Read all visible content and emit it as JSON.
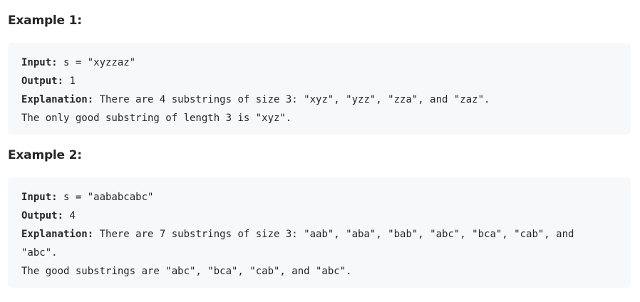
{
  "examples": [
    {
      "heading": "Example 1:",
      "input_label": "Input:",
      "input_value": " s = \"xyzzaz\"",
      "output_label": "Output:",
      "output_value": " 1",
      "explanation_label": "Explanation:",
      "explanation_lines": [
        " There are 4 substrings of size 3: \"xyz\", \"yzz\", \"zza\", and \"zaz\".",
        "The only good substring of length 3 is \"xyz\"."
      ]
    },
    {
      "heading": "Example 2:",
      "input_label": "Input:",
      "input_value": " s = \"aababcabc\"",
      "output_label": "Output:",
      "output_value": " 4",
      "explanation_label": "Explanation:",
      "explanation_lines": [
        " There are 7 substrings of size 3: \"aab\", \"aba\", \"bab\", \"abc\", \"bca\", \"cab\", and",
        "\"abc\".",
        "The good substrings are \"abc\", \"bca\", \"cab\", and \"abc\"."
      ]
    }
  ]
}
